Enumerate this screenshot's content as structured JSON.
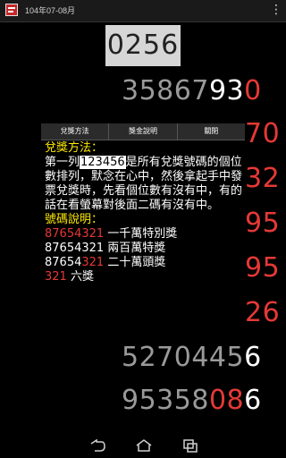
{
  "appbar": {
    "title": "104年07-08月",
    "overflow_icon": "overflow-menu-icon"
  },
  "current_code": "0256",
  "numbers": [
    {
      "prefix": "35867",
      "mid": "93",
      "tail": "0"
    },
    {
      "prefix": "",
      "mid": "",
      "tail": "70"
    },
    {
      "prefix": "",
      "mid": "",
      "tail": "32"
    },
    {
      "prefix": "",
      "mid": "",
      "tail": "95"
    },
    {
      "prefix": "",
      "mid": "",
      "tail": "95"
    },
    {
      "prefix": "",
      "mid": "",
      "tail": "26"
    },
    {
      "prefix": "5270445",
      "mid": "6",
      "tail": ""
    },
    {
      "prefix": "95358",
      "mid": "08",
      "tail": "6"
    }
  ],
  "dialog": {
    "tabs": [
      "兌獎方法",
      "獎金說明",
      "關閉"
    ],
    "method_title": "兌獎方法：",
    "method_text_1": "第一列",
    "method_highlight": "123456",
    "method_text_2": "是所有兌獎號碼的個位數排列，默念在心中，然後拿起手中發票兌獎時，先看個位數有沒有中，有的話在看螢幕對後面二碼有沒有中。",
    "code_title": "號碼說明：",
    "items": [
      {
        "red": "87654321",
        "white": "",
        "label": " 一千萬特別獎"
      },
      {
        "red": "",
        "white": "87654321",
        "label": " 兩百萬特獎"
      },
      {
        "red_tail": "321",
        "white": "87654",
        "label": " 二十萬頭獎"
      },
      {
        "red": "321",
        "white": "",
        "label": " 六獎"
      }
    ]
  },
  "nav": {
    "back_icon": "back-icon",
    "home_icon": "home-icon",
    "recent_icon": "recent-apps-icon"
  }
}
